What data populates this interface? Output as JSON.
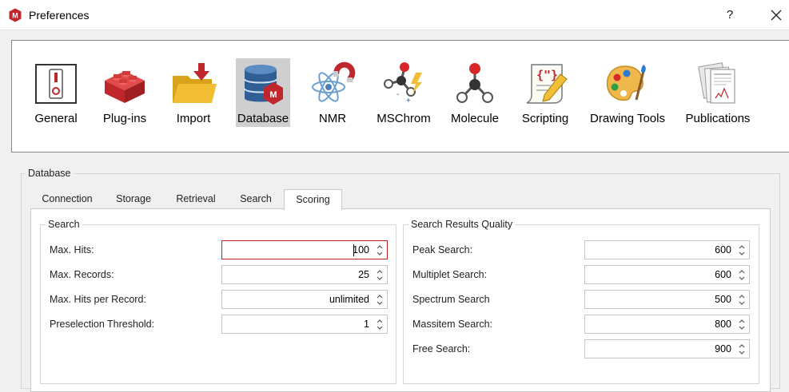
{
  "window": {
    "title": "Preferences",
    "help_label": "?"
  },
  "toolbar": {
    "items": [
      {
        "label": "General",
        "icon": "switch-icon"
      },
      {
        "label": "Plug-ins",
        "icon": "lego-brick-icon"
      },
      {
        "label": "Import",
        "icon": "folder-import-icon"
      },
      {
        "label": "Database",
        "icon": "database-icon",
        "selected": true
      },
      {
        "label": "NMR",
        "icon": "atom-magnet-icon"
      },
      {
        "label": "MSChrom",
        "icon": "molecule-ions-icon"
      },
      {
        "label": "Molecule",
        "icon": "molecule-icon"
      },
      {
        "label": "Scripting",
        "icon": "script-scroll-icon"
      },
      {
        "label": "Drawing Tools",
        "icon": "palette-icon"
      },
      {
        "label": "Publications",
        "icon": "documents-icon"
      }
    ]
  },
  "database_group": {
    "title": "Database",
    "tabs": [
      {
        "label": "Connection"
      },
      {
        "label": "Storage"
      },
      {
        "label": "Retrieval"
      },
      {
        "label": "Search"
      },
      {
        "label": "Scoring",
        "active": true
      }
    ],
    "search": {
      "title": "Search",
      "fields": [
        {
          "label": "Max. Hits:",
          "value": "100"
        },
        {
          "label": "Max. Records:",
          "value": "25"
        },
        {
          "label": "Max. Hits per Record:",
          "value": "unlimited"
        },
        {
          "label": "Preselection Threshold:",
          "value": "1"
        }
      ]
    },
    "quality": {
      "title": "Search Results Quality",
      "fields": [
        {
          "label": "Peak Search:",
          "value": "600"
        },
        {
          "label": "Multiplet Search:",
          "value": "600"
        },
        {
          "label": "Spectrum Search",
          "value": "500"
        },
        {
          "label": "Massitem Search:",
          "value": "800"
        },
        {
          "label": "Free Search:",
          "value": "900"
        }
      ]
    }
  },
  "colors": {
    "brand_red": "#c0272d",
    "selected_bg": "#cfcfcf",
    "focus_border": "#c31f1f"
  }
}
